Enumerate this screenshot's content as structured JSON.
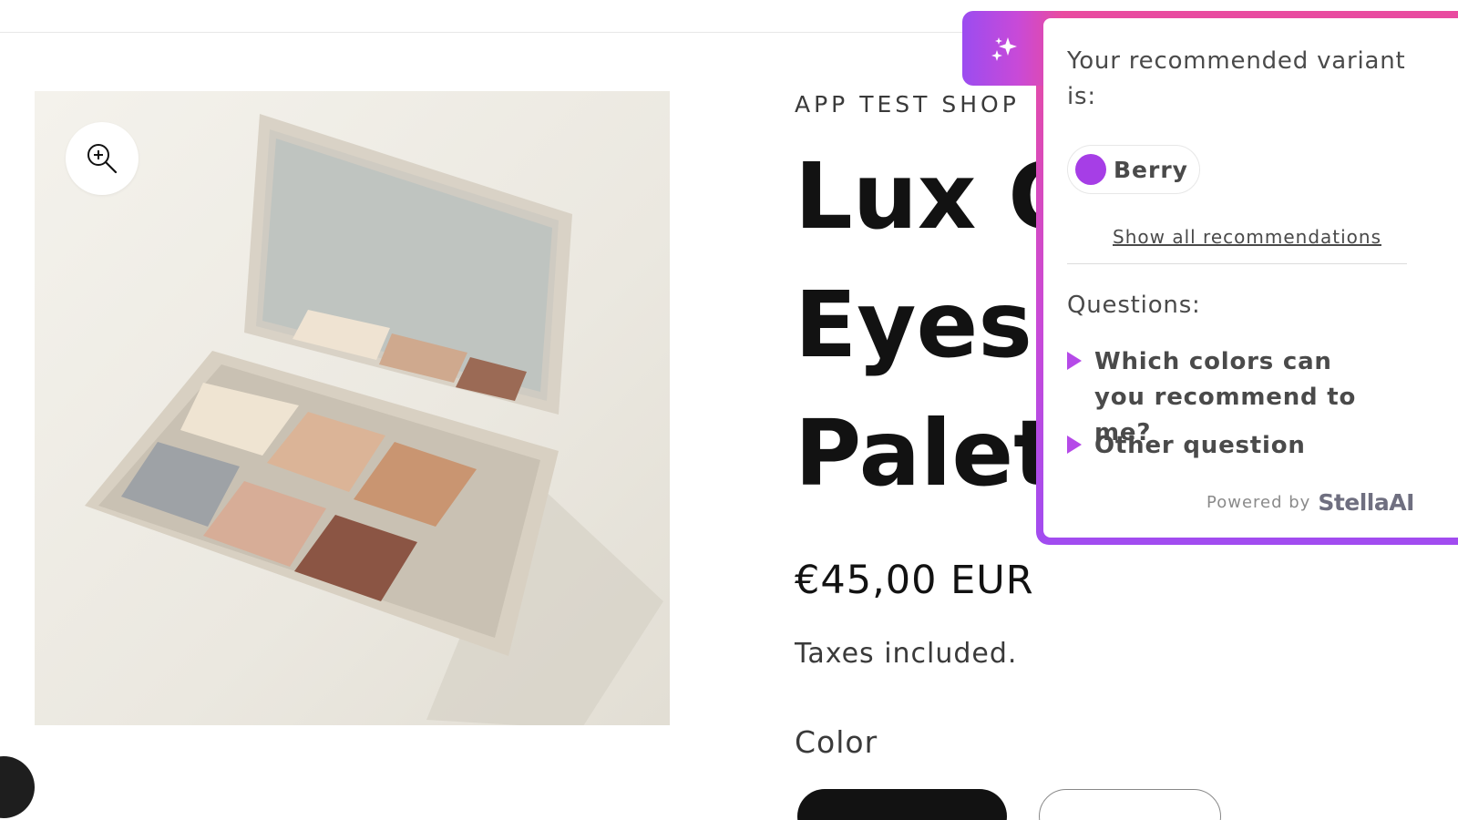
{
  "header": {},
  "media": {
    "zoom_icon": "zoom-in-icon",
    "image_description_icon": "eyeshadow-palette-image"
  },
  "product": {
    "vendor": "APP TEST SHOP",
    "title": "Lux Q\nEyesh\nPalett",
    "price": "€45,00 EUR",
    "tax_note": "Taxes included.",
    "color_label": "Color"
  },
  "widget": {
    "tab_icon": "sparkle-icon",
    "recommended_text": "Your recommended variant is:",
    "variant_name": "Berry",
    "variant_color": "#a63ee6",
    "show_all": "Show all recommendations",
    "questions_label": "Questions:",
    "questions": [
      "Which colors can you recommend to me?",
      "Other question"
    ],
    "powered_by": "Powered by",
    "brand_name": "StellaAI",
    "accent_gradient": [
      "#9b4cf0",
      "#e94b9f"
    ]
  }
}
